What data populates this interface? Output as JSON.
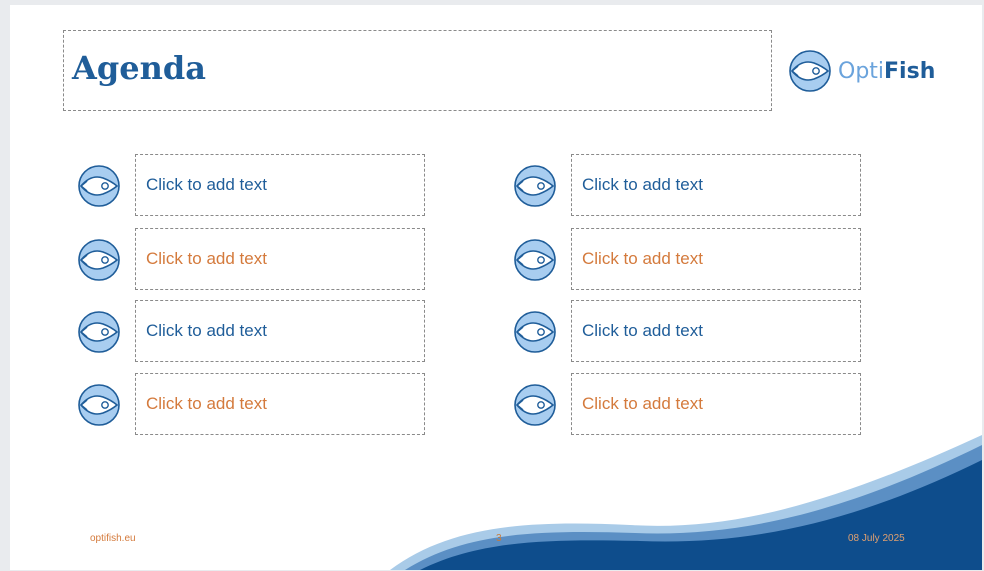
{
  "slide": {
    "title": "Agenda",
    "logo": {
      "part1": "Opti",
      "part2": "Fish"
    },
    "items_left": [
      {
        "text": "Click to add text",
        "color": "blue"
      },
      {
        "text": "Click to add text",
        "color": "orange"
      },
      {
        "text": "Click to add text",
        "color": "blue"
      },
      {
        "text": "Click to add text",
        "color": "orange"
      }
    ],
    "items_right": [
      {
        "text": "Click to add text",
        "color": "blue"
      },
      {
        "text": "Click to add text",
        "color": "orange"
      },
      {
        "text": "Click to add text",
        "color": "blue"
      },
      {
        "text": "Click to add text",
        "color": "orange"
      }
    ],
    "footer": {
      "website": "optifish.eu",
      "page_number": "3",
      "date": "08 July 2025"
    }
  },
  "colors": {
    "title_blue": "#1f5d99",
    "accent_orange": "#d47a3c",
    "fish_fill": "#a8cdf0",
    "wave_dark": "#0e4d8c",
    "wave_light": "#8fbbe0"
  }
}
